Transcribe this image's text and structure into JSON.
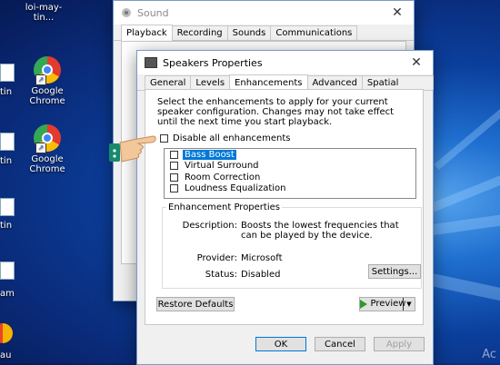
{
  "desktop": {
    "icons": [
      {
        "label": "loi-may-tin..."
      },
      {
        "label": "Google Chrome"
      },
      {
        "label": "Google Chrome"
      }
    ],
    "partial_labels": [
      "tin",
      "tin",
      "tin",
      "tin",
      "am",
      "au"
    ],
    "watermark": "Ac"
  },
  "sound_window": {
    "title": "Sound",
    "tabs": [
      "Playback",
      "Recording",
      "Sounds",
      "Communications"
    ],
    "active_tab": "Playback"
  },
  "props_window": {
    "title": "Speakers Properties",
    "tabs": [
      "General",
      "Levels",
      "Enhancements",
      "Advanced",
      "Spatial sound"
    ],
    "active_tab": "Enhancements",
    "description": "Select the enhancements to apply for your current speaker configuration. Changes may not take effect until the next time you start playback.",
    "disable_all_label": "Disable all enhancements",
    "disable_all_checked": false,
    "enhancements": [
      {
        "label": "Bass Boost",
        "checked": false,
        "selected": true
      },
      {
        "label": "Virtual Surround",
        "checked": false,
        "selected": false
      },
      {
        "label": "Room Correction",
        "checked": false,
        "selected": false
      },
      {
        "label": "Loudness Equalization",
        "checked": false,
        "selected": false
      }
    ],
    "properties_title": "Enhancement Properties",
    "description_key": "Description:",
    "description_value": "Boosts the lowest frequencies that can be played by the device.",
    "provider_key": "Provider:",
    "provider_value": "Microsoft",
    "status_key": "Status:",
    "status_value": "Disabled",
    "settings_label": "Settings...",
    "restore_label": "Restore Defaults",
    "preview_label": "Preview",
    "ok_label": "OK",
    "cancel_label": "Cancel",
    "apply_label": "Apply"
  },
  "colors": {
    "accent": "#0078d7",
    "play_green": "#2c9b2c"
  }
}
